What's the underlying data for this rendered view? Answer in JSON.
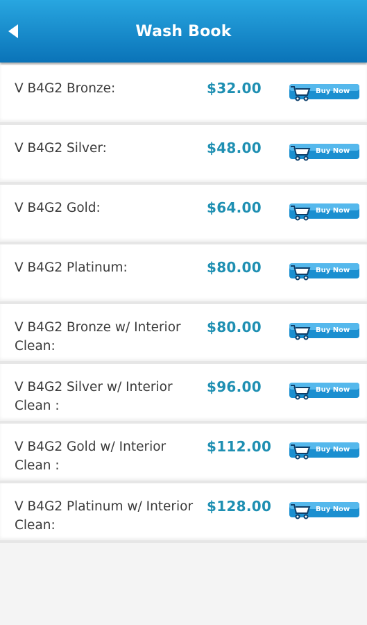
{
  "header": {
    "title": "Wash Book",
    "back_icon": "back-arrow-icon"
  },
  "buy_label": "Buy Now",
  "colors": {
    "header_top": "#28a6e0",
    "header_bottom": "#0a73b8",
    "price": "#1e8fb2",
    "button": "#1b8fd0"
  },
  "items": [
    {
      "name": "V B4G2 Bronze:",
      "price": "$32.00"
    },
    {
      "name": "V B4G2 Silver:",
      "price": "$48.00"
    },
    {
      "name": "V B4G2 Gold:",
      "price": "$64.00"
    },
    {
      "name": "V B4G2 Platinum:",
      "price": "$80.00"
    },
    {
      "name": "V B4G2 Bronze w/ Interior Clean:",
      "price": "$80.00"
    },
    {
      "name": "V B4G2 Silver w/ Interior Clean :",
      "price": "$96.00"
    },
    {
      "name": "V B4G2 Gold w/ Interior Clean :",
      "price": "$112.00"
    },
    {
      "name": "V B4G2 Platinum w/ Interior Clean:",
      "price": "$128.00"
    }
  ]
}
